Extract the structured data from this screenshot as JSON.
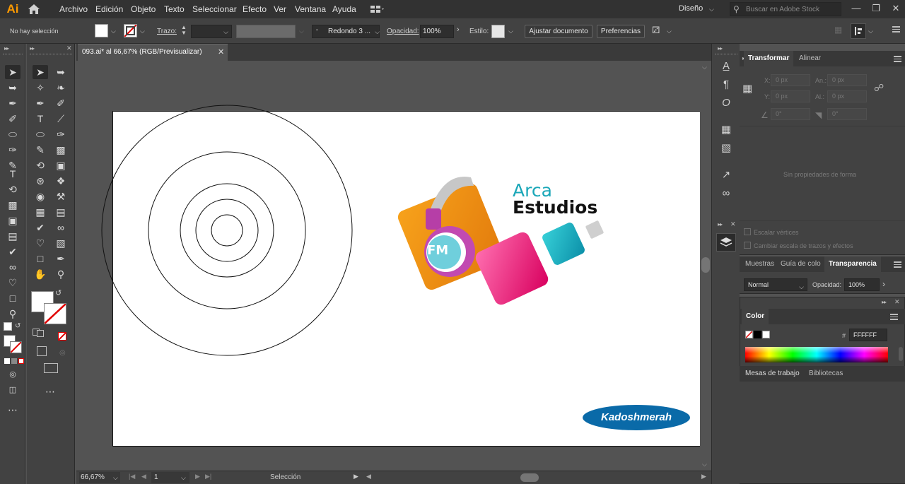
{
  "app": {
    "logo": "Ai",
    "workspace": "Diseño",
    "search_placeholder": "Buscar en Adobe Stock"
  },
  "menu": [
    "Archivo",
    "Edición",
    "Objeto",
    "Texto",
    "Seleccionar",
    "Efecto",
    "Ver",
    "Ventana",
    "Ayuda"
  ],
  "control": {
    "selection": "No hay selección",
    "stroke_label": "Trazo:",
    "brush": "Redondo 3 ...",
    "opacity_label": "Opacidad:",
    "opacity_value": "100%",
    "style_label": "Estilo:",
    "adjust_doc": "Ajustar documento",
    "prefs": "Preferencias"
  },
  "document": {
    "tab_title": "093.ai* al 66,67% (RGB/Previsualizar)",
    "artboard": {
      "logo_line1": "Arca",
      "logo_line2": "Estudios",
      "logo_fm": "FM",
      "watermark": "Kadoshmerah"
    }
  },
  "status": {
    "zoom": "66,67%",
    "artboard_num": "1",
    "tool": "Selección"
  },
  "panels": {
    "transform_tabs": [
      "Transformar",
      "Alinear"
    ],
    "transform": {
      "x_label": "X:",
      "x_value": "0 px",
      "y_label": "Y:",
      "y_value": "0 px",
      "w_label": "An.:",
      "w_value": "0 px",
      "h_label": "Al.:",
      "h_value": "0 px",
      "angle_value": "0°",
      "shear_value": "0°",
      "no_shape": "Sin propiedades de forma",
      "scale_corners": "Escalar vértices",
      "scale_strokes": "Cambiar escala de trazos y efectos"
    },
    "transparency_tabs": [
      "Muestras",
      "Guía de colo",
      "Transparencia"
    ],
    "transparency": {
      "blend_mode": "Normal",
      "opacity_label": "Opacidad:",
      "opacity_value": "100%"
    },
    "color": {
      "title": "Color",
      "hex_label": "#",
      "hex_value": "FFFFFF"
    },
    "artboards_tabs": [
      "Mesas de trabajo",
      "Bibliotecas"
    ]
  },
  "colors": {
    "accent_orange": "#ff9a00",
    "logo_teal": "#1aa7b8",
    "watermark_blue": "#0a6aa8"
  }
}
